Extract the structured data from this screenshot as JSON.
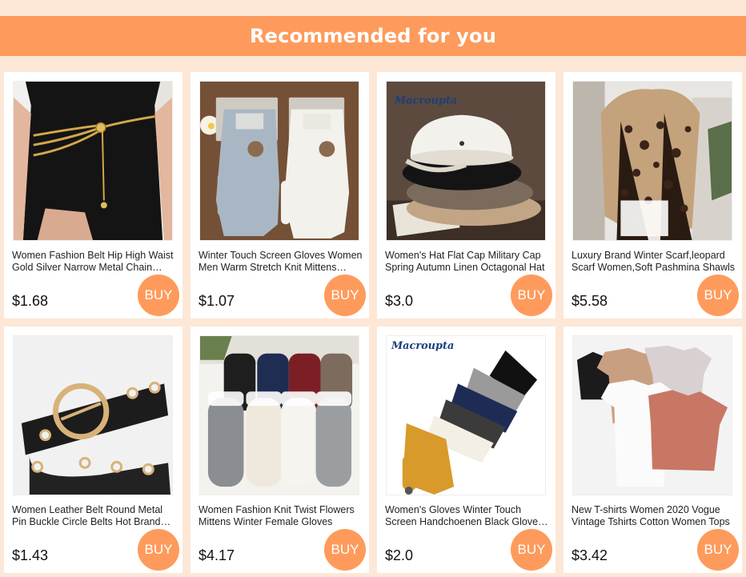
{
  "header": {
    "title": "Recommended for you"
  },
  "buy_label": "BUY",
  "brand_text": "Macroupta",
  "colors": {
    "accent": "#fe9b5c",
    "background": "#fde7d6"
  },
  "products": [
    {
      "title": "Women Fashion Belt Hip High Waist Gold Silver Narrow Metal Chain Chunky Fringes Gold Women Dress Chain Belt",
      "price": "$1.68",
      "image": "chain-belt-photo"
    },
    {
      "title": "Winter Touch Screen Gloves Women Men Warm Stretch Knit Mittens Imitation Wool Full Finger",
      "price": "$1.07",
      "image": "knit-gloves-photo"
    },
    {
      "title": "Women's Hat Flat Cap Military Cap Spring Autumn Linen Octagonal Hat",
      "price": "$3.0",
      "image": "flat-caps-photo"
    },
    {
      "title": "Luxury Brand Winter Scarf,leopard Scarf Women,Soft Pashmina Shawls",
      "price": "$5.58",
      "image": "leopard-scarf-photo"
    },
    {
      "title": "Women Leather Belt Round Metal Pin Buckle Circle Belts Hot Brand Designer",
      "price": "$1.43",
      "image": "leather-belt-photo"
    },
    {
      "title": "Women Fashion Knit Twist Flowers Mittens Winter Female Gloves",
      "price": "$4.17",
      "image": "knit-mittens-photo"
    },
    {
      "title": "Women's Gloves Winter Touch Screen Handchoenen Black Gloves Knitted",
      "price": "$2.0",
      "image": "touch-gloves-photo"
    },
    {
      "title": "New T-shirts Women 2020 Vogue Vintage Tshirts Cotton Women Tops",
      "price": "$3.42",
      "image": "tshirts-photo"
    }
  ]
}
